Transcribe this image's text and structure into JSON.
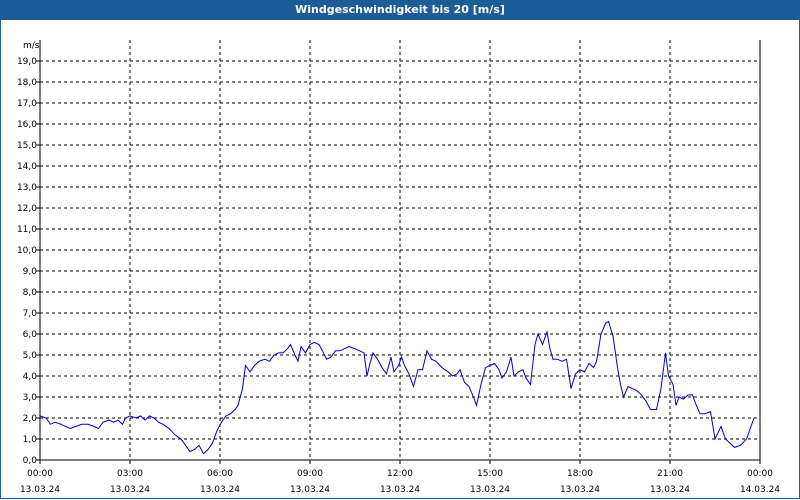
{
  "window": {
    "title": "Windgeschwindigkeit bis 20 [m/s]"
  },
  "chart_data": {
    "type": "line",
    "title": "Windgeschwindigkeit bis 20 [m/s]",
    "ylabel": "m/s",
    "xlabel": "",
    "ylim": [
      0,
      20
    ],
    "y_ticks": [
      "0,0",
      "1,0",
      "2,0",
      "3,0",
      "4,0",
      "5,0",
      "6,0",
      "7,0",
      "8,0",
      "9,0",
      "10,0",
      "11,0",
      "12,0",
      "13,0",
      "14,0",
      "15,0",
      "16,0",
      "17,0",
      "18,0",
      "19,0"
    ],
    "x_ticks": [
      {
        "time": "00:00",
        "date": "13.03.24"
      },
      {
        "time": "03:00",
        "date": "13.03.24"
      },
      {
        "time": "06:00",
        "date": "13.03.24"
      },
      {
        "time": "09:00",
        "date": "13.03.24"
      },
      {
        "time": "12:00",
        "date": "13.03.24"
      },
      {
        "time": "15:00",
        "date": "13.03.24"
      },
      {
        "time": "18:00",
        "date": "13.03.24"
      },
      {
        "time": "21:00",
        "date": "13.03.24"
      },
      {
        "time": "00:00",
        "date": "14.03.24"
      }
    ],
    "grid": true,
    "line_color": "#0000cc",
    "series": [
      {
        "x_unit": "hours",
        "points": [
          [
            0.0,
            2.1
          ],
          [
            0.2,
            2.0
          ],
          [
            0.35,
            1.7
          ],
          [
            0.5,
            1.8
          ],
          [
            0.7,
            1.7
          ],
          [
            0.85,
            1.6
          ],
          [
            1.0,
            1.5
          ],
          [
            1.2,
            1.6
          ],
          [
            1.4,
            1.7
          ],
          [
            1.6,
            1.7
          ],
          [
            1.8,
            1.6
          ],
          [
            1.95,
            1.5
          ],
          [
            2.1,
            1.8
          ],
          [
            2.3,
            1.9
          ],
          [
            2.45,
            1.8
          ],
          [
            2.6,
            1.9
          ],
          [
            2.75,
            1.7
          ],
          [
            2.85,
            2.0
          ],
          [
            3.0,
            2.1
          ],
          [
            3.2,
            2.0
          ],
          [
            3.35,
            2.1
          ],
          [
            3.5,
            1.9
          ],
          [
            3.65,
            2.1
          ],
          [
            3.8,
            2.0
          ],
          [
            3.95,
            1.8
          ],
          [
            4.1,
            1.7
          ],
          [
            4.3,
            1.5
          ],
          [
            4.5,
            1.2
          ],
          [
            4.7,
            1.0
          ],
          [
            4.85,
            0.7
          ],
          [
            5.0,
            0.4
          ],
          [
            5.15,
            0.5
          ],
          [
            5.3,
            0.7
          ],
          [
            5.45,
            0.3
          ],
          [
            5.6,
            0.5
          ],
          [
            5.75,
            0.8
          ],
          [
            5.9,
            1.4
          ],
          [
            6.05,
            1.8
          ],
          [
            6.2,
            2.1
          ],
          [
            6.35,
            2.2
          ],
          [
            6.5,
            2.4
          ],
          [
            6.6,
            2.6
          ],
          [
            6.75,
            3.4
          ],
          [
            6.85,
            4.5
          ],
          [
            7.0,
            4.2
          ],
          [
            7.15,
            4.5
          ],
          [
            7.3,
            4.7
          ],
          [
            7.5,
            4.8
          ],
          [
            7.65,
            4.7
          ],
          [
            7.8,
            5.0
          ],
          [
            7.95,
            5.1
          ],
          [
            8.1,
            5.1
          ],
          [
            8.25,
            5.3
          ],
          [
            8.35,
            5.5
          ],
          [
            8.5,
            5.0
          ],
          [
            8.6,
            4.7
          ],
          [
            8.7,
            5.4
          ],
          [
            8.85,
            5.1
          ],
          [
            9.0,
            5.5
          ],
          [
            9.15,
            5.6
          ],
          [
            9.3,
            5.5
          ],
          [
            9.45,
            5.1
          ],
          [
            9.55,
            4.8
          ],
          [
            9.7,
            4.9
          ],
          [
            9.85,
            5.2
          ],
          [
            10.0,
            5.2
          ],
          [
            10.15,
            5.3
          ],
          [
            10.3,
            5.4
          ],
          [
            10.5,
            5.3
          ],
          [
            10.65,
            5.2
          ],
          [
            10.8,
            5.1
          ],
          [
            10.9,
            4.0
          ],
          [
            11.0,
            4.6
          ],
          [
            11.1,
            5.1
          ],
          [
            11.25,
            4.8
          ],
          [
            11.4,
            4.4
          ],
          [
            11.55,
            4.1
          ],
          [
            11.7,
            4.9
          ],
          [
            11.8,
            4.2
          ],
          [
            11.95,
            4.5
          ],
          [
            12.05,
            4.9
          ],
          [
            12.15,
            4.5
          ],
          [
            12.3,
            4.1
          ],
          [
            12.45,
            3.5
          ],
          [
            12.6,
            4.3
          ],
          [
            12.75,
            4.3
          ],
          [
            12.9,
            5.2
          ],
          [
            13.05,
            4.8
          ],
          [
            13.2,
            4.7
          ],
          [
            13.4,
            4.4
          ],
          [
            13.6,
            4.2
          ],
          [
            13.75,
            4.0
          ],
          [
            13.9,
            4.1
          ],
          [
            14.0,
            4.3
          ],
          [
            14.15,
            3.7
          ],
          [
            14.3,
            3.5
          ],
          [
            14.45,
            3.0
          ],
          [
            14.55,
            2.6
          ],
          [
            14.7,
            3.6
          ],
          [
            14.85,
            4.4
          ],
          [
            15.0,
            4.5
          ],
          [
            15.15,
            4.6
          ],
          [
            15.3,
            4.3
          ],
          [
            15.4,
            3.9
          ],
          [
            15.55,
            4.2
          ],
          [
            15.7,
            4.9
          ],
          [
            15.8,
            4.0
          ],
          [
            15.95,
            4.2
          ],
          [
            16.1,
            4.3
          ],
          [
            16.2,
            3.9
          ],
          [
            16.35,
            3.6
          ],
          [
            16.5,
            5.5
          ],
          [
            16.6,
            6.0
          ],
          [
            16.75,
            5.5
          ],
          [
            16.9,
            6.1
          ],
          [
            17.0,
            5.3
          ],
          [
            17.1,
            4.8
          ],
          [
            17.25,
            4.8
          ],
          [
            17.4,
            4.7
          ],
          [
            17.55,
            4.8
          ],
          [
            17.7,
            3.4
          ],
          [
            17.85,
            4.1
          ],
          [
            18.0,
            4.3
          ],
          [
            18.15,
            4.2
          ],
          [
            18.3,
            4.6
          ],
          [
            18.45,
            4.4
          ],
          [
            18.55,
            4.7
          ],
          [
            18.7,
            6.0
          ],
          [
            18.85,
            6.5
          ],
          [
            18.95,
            6.6
          ],
          [
            19.1,
            5.9
          ],
          [
            19.25,
            4.4
          ],
          [
            19.35,
            3.6
          ],
          [
            19.45,
            3.0
          ],
          [
            19.6,
            3.5
          ],
          [
            19.75,
            3.4
          ],
          [
            19.9,
            3.3
          ],
          [
            20.05,
            3.1
          ],
          [
            20.2,
            2.8
          ],
          [
            20.35,
            2.4
          ],
          [
            20.55,
            2.4
          ],
          [
            20.7,
            3.4
          ],
          [
            20.85,
            5.1
          ],
          [
            20.95,
            4.0
          ],
          [
            21.1,
            3.6
          ],
          [
            21.2,
            2.6
          ],
          [
            21.3,
            3.0
          ],
          [
            21.45,
            2.9
          ],
          [
            21.6,
            3.1
          ],
          [
            21.75,
            3.1
          ],
          [
            21.85,
            2.7
          ],
          [
            22.0,
            2.2
          ],
          [
            22.15,
            2.2
          ],
          [
            22.35,
            2.3
          ],
          [
            22.5,
            1.0
          ],
          [
            22.7,
            1.6
          ],
          [
            22.85,
            1.0
          ],
          [
            23.0,
            0.8
          ],
          [
            23.15,
            0.6
          ],
          [
            23.35,
            0.7
          ],
          [
            23.55,
            1.0
          ],
          [
            23.8,
            2.0
          ]
        ]
      }
    ]
  }
}
